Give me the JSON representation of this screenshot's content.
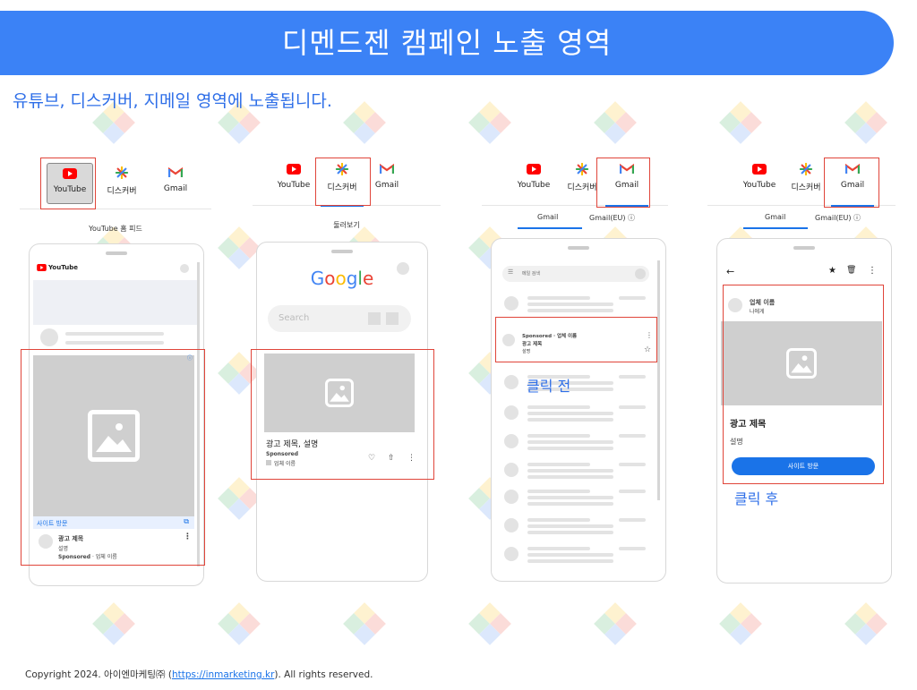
{
  "header": {
    "title": "디멘드젠 캠페인 노출 영역",
    "subtitle": "유튜브, 디스커버, 지메일 영역에 노출됩니다."
  },
  "tabs": {
    "youtube": "YouTube",
    "discover": "디스커버",
    "gmail": "Gmail"
  },
  "colors": {
    "banner": "#3b82f6",
    "accent": "#1a73e8",
    "highlight_box": "#e0453a",
    "youtube_red": "#ff0000"
  },
  "panel1": {
    "caption": "YouTube 홈 피드",
    "logo_text": "YouTube",
    "site_visit": "사이트 방문",
    "ad_title": "광고 제목",
    "desc": "설명",
    "sponsored": "Sponsored",
    "advertiser": "· 업체 이름",
    "info_icon": "info-icon"
  },
  "panel2": {
    "caption": "둘러보기",
    "google_logo": "Google",
    "search_placeholder": "Search",
    "ad_title": "광고 제목, 설명",
    "sponsored": "Sponsored",
    "advertiser": "업체 이름"
  },
  "panel3": {
    "sub_tab_1": "Gmail",
    "sub_tab_2": "Gmail(EU)",
    "search_placeholder": "메일 검색",
    "sponsored_line": "Sponsored · 업체 이름",
    "ad_title": "광고 제목",
    "desc": "설명",
    "click_label": "클릭 전"
  },
  "panel4": {
    "sub_tab_1": "Gmail",
    "sub_tab_2": "Gmail(EU)",
    "advertiser": "업체 이름",
    "to_me": "나에게",
    "ad_title": "광고 제목",
    "desc": "설명",
    "button": "사이트 방문",
    "click_label": "클릭 후"
  },
  "footer": {
    "prefix": "Copyright 2024. 아이엔마케팅㈜ (",
    "link": "https://inmarketing.kr",
    "suffix": "). All rights reserved."
  }
}
